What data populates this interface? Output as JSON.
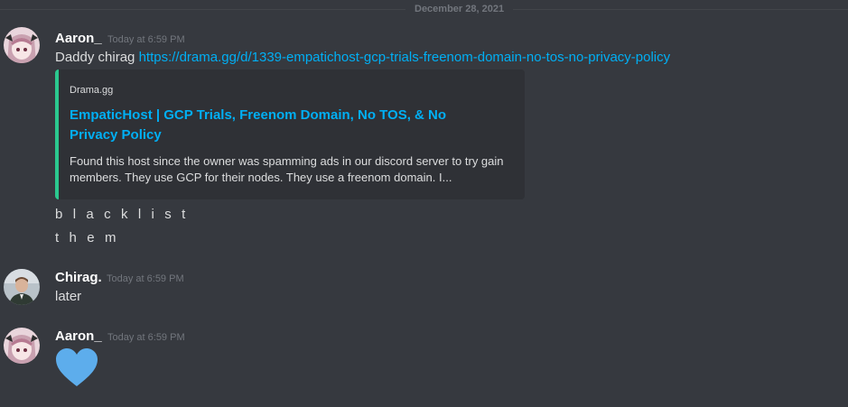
{
  "date_divider": "December 28, 2021",
  "messages": [
    {
      "username": "Aaron_",
      "timestamp": "Today at 6:59 PM",
      "text_prefix": "Daddy chirag ",
      "link": "https://drama.gg/d/1339-empatichost-gcp-trials-freenom-domain-no-tos-no-privacy-policy",
      "embed": {
        "provider": "Drama.gg",
        "title": "EmpaticHost | GCP Trials, Freenom Domain, No TOS, & No Privacy Policy",
        "description": "Found this host since the owner was spamming ads in our discord server to try gain members. They use GCP for their nodes. They use a freenom domain. I...",
        "accent_color": "#2bc88f"
      },
      "followups": [
        "b l a c k l i s t",
        "t h e m"
      ]
    },
    {
      "username": "Chirag.",
      "timestamp": "Today at 6:59 PM",
      "text": "later"
    },
    {
      "username": "Aaron_",
      "timestamp": "Today at 6:59 PM",
      "emoji": "blue-heart"
    }
  ]
}
